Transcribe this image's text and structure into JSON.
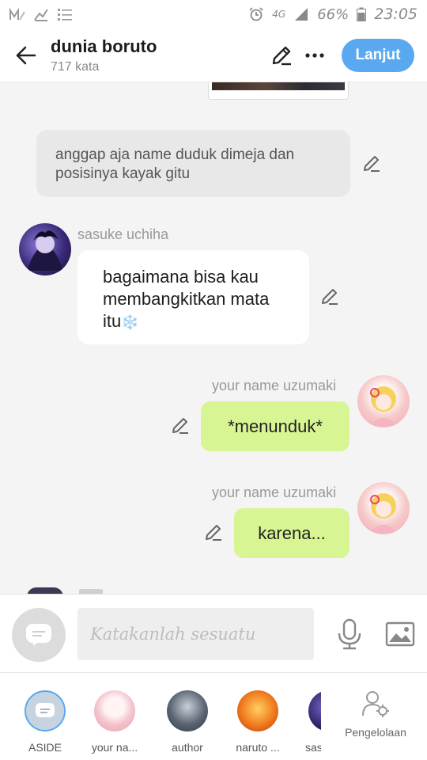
{
  "status_bar": {
    "network": "4G",
    "battery": "66%",
    "time": "23:05"
  },
  "header": {
    "title": "dunia boruto",
    "word_count": "717 kata",
    "next_label": "Lanjut"
  },
  "messages": {
    "aside_text": "anggap aja name duduk dimeja dan posisinya kayak gitu",
    "sasuke_name": "sasuke uchiha",
    "sasuke_text": "bagaimana bisa kau membangkitkan mata itu",
    "sasuke_emoji": "❄️",
    "yn1_name": "your name uzumaki",
    "yn1_text": "*menunduk*",
    "yn2_name": "your name uzumaki",
    "yn2_text": "karena..."
  },
  "composer": {
    "placeholder": "Katakanlah sesuatu"
  },
  "characters": [
    {
      "label": "ASIDE"
    },
    {
      "label": "your na..."
    },
    {
      "label": "author"
    },
    {
      "label": "naruto ..."
    },
    {
      "label": "sas"
    }
  ],
  "manage_label": "Pengelolaan",
  "colors": {
    "accent": "#5aa9f0",
    "own_bubble": "#d7f593",
    "aside_bubble": "#e8e8e8"
  }
}
